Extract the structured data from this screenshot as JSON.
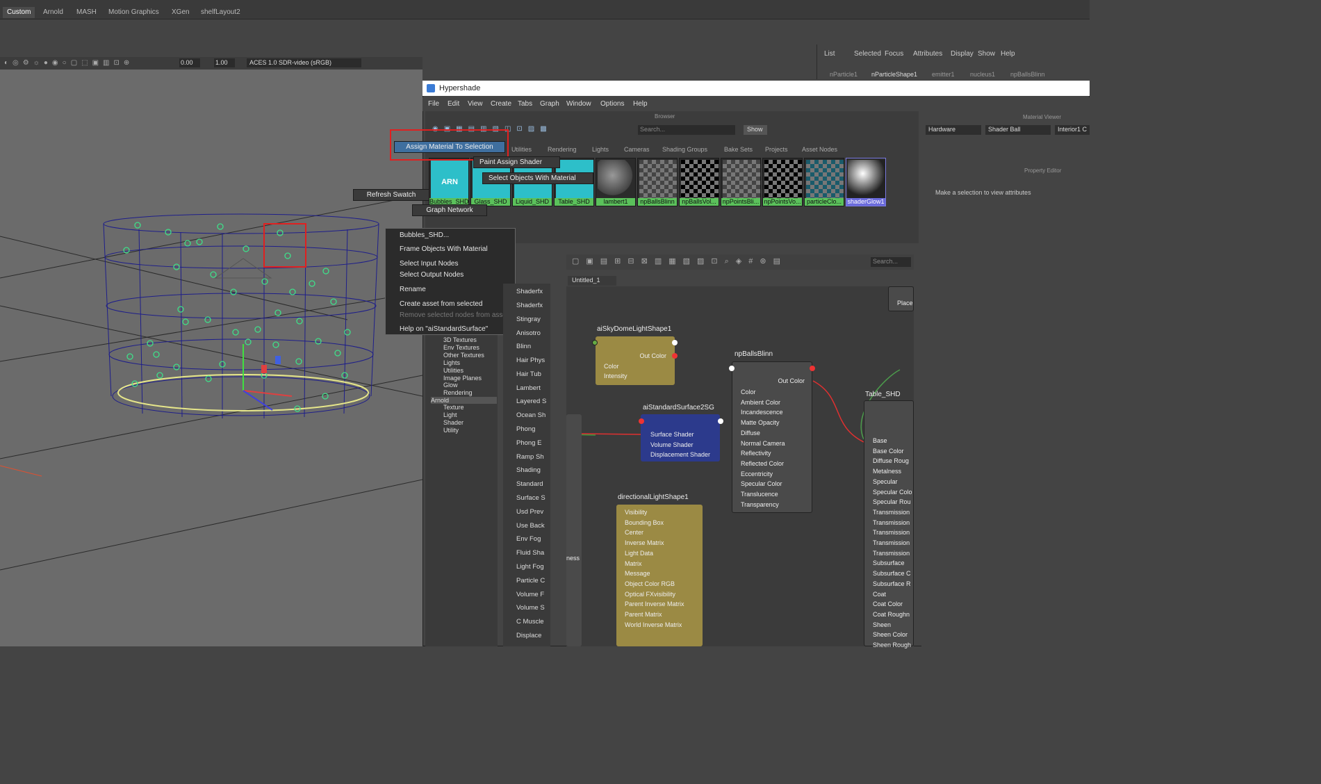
{
  "shelf": {
    "tabs": [
      "Custom",
      "Arnold",
      "MASH",
      "Motion Graphics",
      "XGen",
      "shelfLayout2"
    ]
  },
  "viewport_toolbar": {
    "value1": "0.00",
    "value2": "1.00",
    "colorspace": "ACES 1.0 SDR-video (sRGB)"
  },
  "channel_box": {
    "menus": [
      "List",
      "Selected",
      "Focus",
      "Attributes",
      "Display",
      "Show",
      "Help"
    ],
    "tabs": [
      "nParticle1",
      "nParticleShape1",
      "emitter1",
      "nucleus1",
      "npBallsBlinn"
    ]
  },
  "hypershade": {
    "title": "Hypershade",
    "menus": [
      "File",
      "Edit",
      "View",
      "Create",
      "Tabs",
      "Graph",
      "Window",
      "Options",
      "Help"
    ],
    "browser_label": "Browser",
    "search_placeholder": "Search...",
    "show_label": "Show",
    "browser_tabs": [
      "Utilities",
      "Rendering",
      "Lights",
      "Cameras",
      "Shading Groups",
      "Bake Sets",
      "Projects",
      "Asset Nodes"
    ],
    "swatches": [
      "Bubbles_SHD",
      "Glass_SHD",
      "Liquid_SHD",
      "Table_SHD",
      "lambert1",
      "npBallsBlinn",
      "npBallsVol...",
      "npPointsBli...",
      "npPointsVo...",
      "particleClo...",
      "shaderGlow1"
    ],
    "arn_text": "ARN",
    "graph_tab": "Untitled_1",
    "graph_search": "Search...",
    "material_viewer": {
      "title": "Material Viewer",
      "renderer": "Hardware",
      "shape": "Shader Ball",
      "env": "Interior1 C"
    },
    "property_editor": {
      "title": "Property Editor",
      "message": "Make a selection to view attributes"
    }
  },
  "popup_actions": {
    "assign": "Assign Material To Selection",
    "paint": "Paint Assign Shader",
    "select_objects": "Select Objects With Material",
    "refresh": "Refresh Swatch",
    "graph_network": "Graph Network"
  },
  "context_menu": [
    "Bubbles_SHD...",
    "Frame Objects With Material",
    "Select Input Nodes",
    "Select Output Nodes",
    "Rename",
    "Create asset from selected",
    "Remove selected nodes from asset",
    "Help on \"aiStandardSurface\""
  ],
  "create_tree": [
    "3D Textures",
    "Env Textures",
    "Other Textures",
    "Lights",
    "Utilities",
    "Image Planes",
    "Glow",
    "Rendering",
    "Arnold",
    "Texture",
    "Light",
    "Shader",
    "Utility"
  ],
  "create_list": [
    "Shaderfx",
    "Shaderfx",
    "Stingray",
    "Anisotro",
    "Blinn",
    "Hair Phys",
    "Hair Tub",
    "Lambert",
    "Layered S",
    "Ocean Sh",
    "Phong",
    "Phong E",
    "Ramp Sh",
    "Shading",
    "Standard",
    "Surface S",
    "Usd Prev",
    "Use Back",
    "Env Fog",
    "Fluid Sha",
    "Light Fog",
    "Particle C",
    "Volume F",
    "Volume S",
    "C Muscle",
    "Displace"
  ],
  "nodes": {
    "sky": {
      "title": "aiSkyDomeLightShape1",
      "out": "Out Color",
      "rows": [
        "Color",
        "Intensity"
      ]
    },
    "sg": {
      "title": "aiStandardSurface2SG",
      "rows": [
        "Surface Shader",
        "Volume Shader",
        "Displacement Shader"
      ]
    },
    "blinn": {
      "title": "npBallsBlinn",
      "out": "Out Color",
      "rows": [
        "Color",
        "Ambient Color",
        "Incandescence",
        "Matte Opacity",
        "Diffuse",
        "Normal Camera",
        "Reflectivity",
        "Reflected Color",
        "Eccentricity",
        "Specular Color",
        "Translucence",
        "Transparency"
      ]
    },
    "dir": {
      "title": "directionalLightShape1",
      "rows": [
        "Visibility",
        "Bounding Box",
        "Center",
        "Inverse Matrix",
        "Light Data",
        "Matrix",
        "Message",
        "Object Color RGB",
        "Optical FXvisibility",
        "Parent Inverse Matrix",
        "Parent Matrix",
        "World Inverse Matrix"
      ]
    },
    "table": {
      "title": "Table_SHD",
      "rows": [
        "Base",
        "Base Color",
        "Diffuse Roug",
        "Metalness",
        "Specular",
        "Specular Colo",
        "Specular Rou",
        "Transmission",
        "Transmission",
        "Transmission",
        "Transmission",
        "Transmission",
        "Subsurface",
        "Subsurface C",
        "Subsurface R",
        "Coat",
        "Coat Color",
        "Coat Roughn",
        "Sheen",
        "Sheen Color",
        "Sheen Rough"
      ]
    },
    "place": "Place",
    "ness": "ness"
  }
}
